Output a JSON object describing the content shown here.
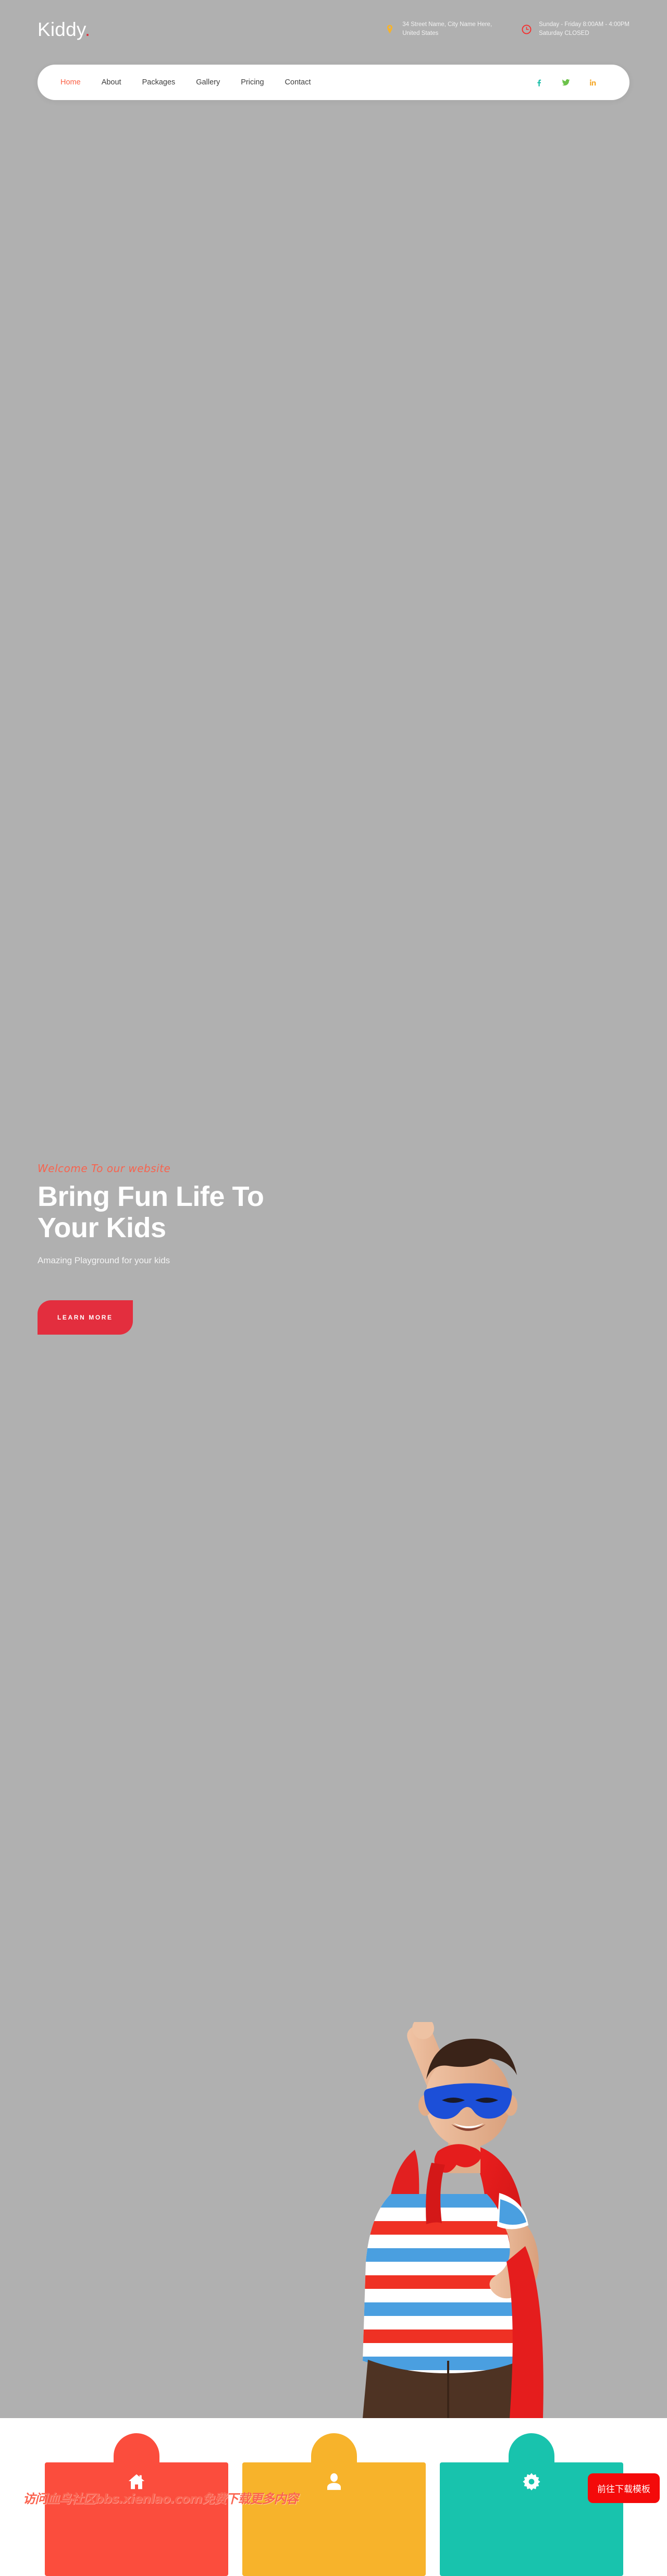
{
  "site": {
    "logo_text": "Kiddy",
    "logo_dot": "."
  },
  "topbar": {
    "address_icon": "map-pin-icon",
    "address_line1": "34 Street Name, City Name Here,",
    "address_line2": "United States",
    "hours_icon": "clock-icon",
    "hours_line1": "Sunday - Friday 8:00AM - 4:00PM",
    "hours_line2": "Saturday CLOSED"
  },
  "nav": {
    "items": [
      {
        "label": "Home",
        "active": true
      },
      {
        "label": "About",
        "active": false
      },
      {
        "label": "Packages",
        "active": false
      },
      {
        "label": "Gallery",
        "active": false
      },
      {
        "label": "Pricing",
        "active": false
      },
      {
        "label": "Contact",
        "active": false
      }
    ],
    "social": [
      {
        "name": "facebook-icon",
        "glyph": "f",
        "color": "#1fbfaa"
      },
      {
        "name": "twitter-icon",
        "glyph": "➤",
        "color": "#6cc24a"
      },
      {
        "name": "linkedin-icon",
        "glyph": "in",
        "color": "#f5a623"
      }
    ]
  },
  "hero": {
    "eyebrow": "Welcome To our website",
    "headline_line1": "Bring Fun Life To",
    "headline_line2": "Your Kids",
    "subcopy": "Amazing Playground for your kids",
    "cta_label": "LEARN MORE",
    "image_alt": "boy-in-superhero-costume",
    "background_color": "#b0b0b0"
  },
  "cards": [
    {
      "icon": "home-icon",
      "color": "#fb4d3d"
    },
    {
      "icon": "user-icon",
      "color": "#f7b32b"
    },
    {
      "icon": "gear-icon",
      "color": "#18c3ad"
    }
  ],
  "overlay": {
    "watermark": "访问血鸟社区bbs.xienlao.com免费下载更多内容",
    "download_button": "前往下载模板"
  },
  "colors": {
    "accent_red": "#e32e3e",
    "accent_coral": "#fb6045",
    "orange": "#f7b32b",
    "teal": "#18c3ad"
  }
}
